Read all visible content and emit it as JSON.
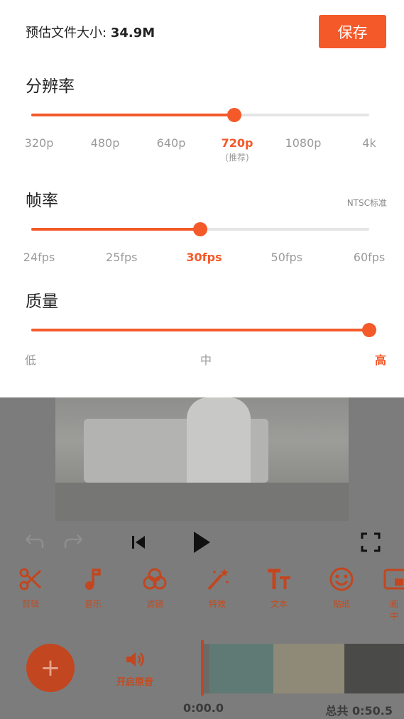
{
  "export": {
    "estimate_label": "预估文件大小:",
    "estimate_value": "34.9M",
    "save_label": "保存"
  },
  "resolution": {
    "title": "分辨率",
    "value_fraction": 0.6,
    "options": [
      "320p",
      "480p",
      "640p",
      "720p",
      "1080p",
      "4k"
    ],
    "selected_index": 3,
    "recommended_note": "(推荐)"
  },
  "framerate": {
    "title": "帧率",
    "standard": "NTSC标准",
    "value_fraction": 0.5,
    "options": [
      "24fps",
      "25fps",
      "30fps",
      "50fps",
      "60fps"
    ],
    "selected_index": 2
  },
  "quality": {
    "title": "质量",
    "value_fraction": 1.0,
    "options": [
      "低",
      "中",
      "高"
    ],
    "selected_index": 2
  },
  "editor": {
    "tools": [
      {
        "label": "剪辑",
        "icon": "scissors-icon"
      },
      {
        "label": "音乐",
        "icon": "music-note-icon"
      },
      {
        "label": "滤镜",
        "icon": "filter-icon"
      },
      {
        "label": "特效",
        "icon": "magic-wand-icon"
      },
      {
        "label": "文本",
        "icon": "text-icon"
      },
      {
        "label": "贴纸",
        "icon": "sticker-icon"
      },
      {
        "label": "画中",
        "icon": "picture-in-picture-icon"
      }
    ],
    "original_sound_label": "开启原音",
    "current_time": "0:00.0",
    "total_time": "总共 0:50.5"
  },
  "colors": {
    "accent": "#f4592a",
    "muted_text": "#9a9a9a"
  }
}
